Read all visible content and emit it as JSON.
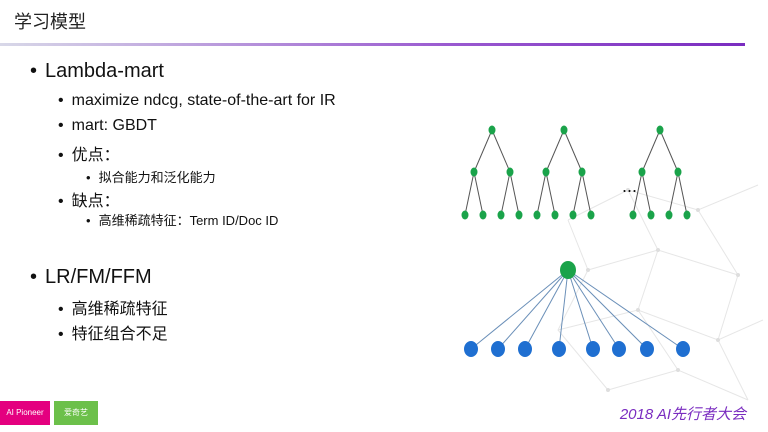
{
  "slide": {
    "title": "学习模型",
    "bullets": [
      {
        "level": 1,
        "text": "Lambda-mart"
      },
      {
        "level": 2,
        "text": "maximize ndcg, state-of-the-art for IR"
      },
      {
        "level": 2,
        "text": "mart: GBDT"
      },
      {
        "level": 2,
        "text": "优点："
      },
      {
        "level": 3,
        "text": "拟合能力和泛化能力"
      },
      {
        "level": 2,
        "text": "缺点："
      },
      {
        "level": 3,
        "text": "高维稀疏特征：Term ID/Doc ID"
      },
      {
        "level": 1,
        "text": "LR/FM/FFM"
      },
      {
        "level": 2,
        "text": "高维稀疏特征"
      },
      {
        "level": 2,
        "text": "特征组合不足"
      }
    ]
  },
  "diagram": {
    "trees_ellipsis": "...",
    "tree_node_color": "#1aa34a",
    "network_top_color": "#1aa34a",
    "network_bottom_color": "#1f6fd1"
  },
  "footer": {
    "logo_left": "AI Pioneer",
    "logo_right": "爱奇艺",
    "event": "2018 AI先行者大会"
  },
  "colors": {
    "accent": "#7a2cc0",
    "pink": "#e4007f"
  }
}
